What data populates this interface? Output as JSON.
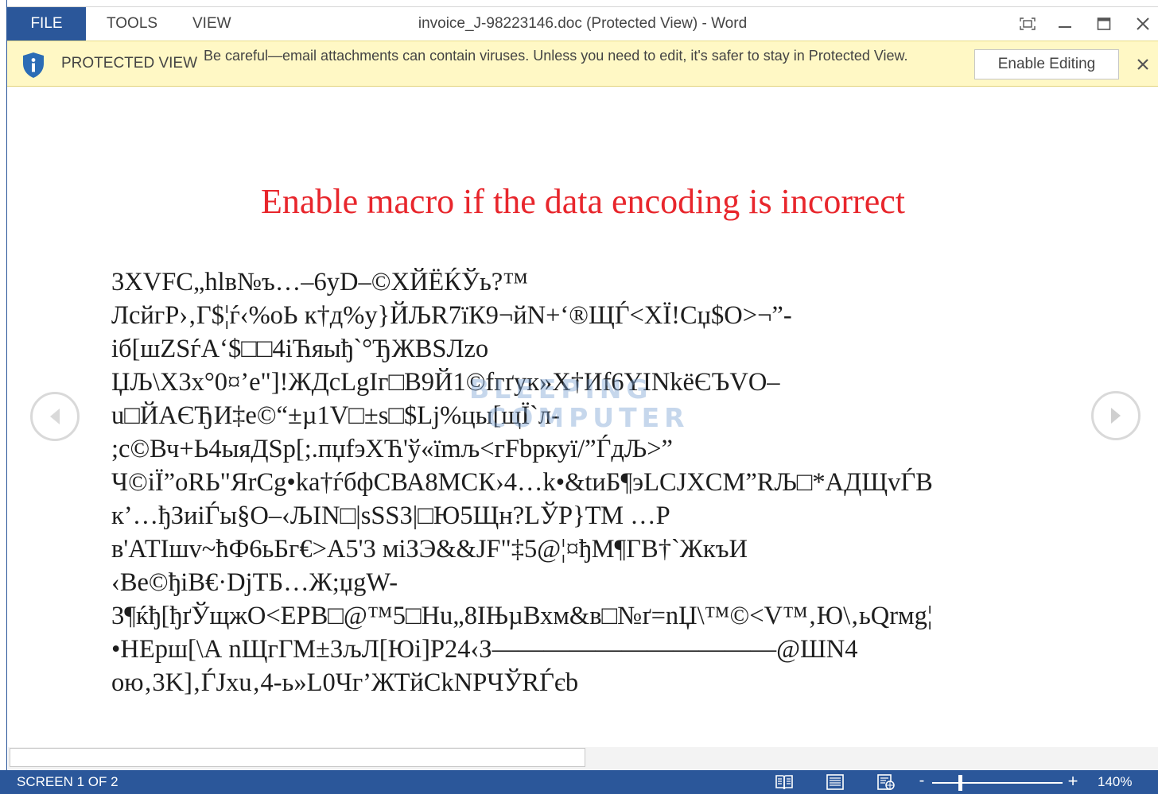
{
  "titlebar": {
    "tabs": {
      "file": "FILE",
      "tools": "TOOLS",
      "view": "VIEW"
    },
    "document_title": "invoice_J-98223146.doc (Protected View) - Word",
    "icons": [
      "restore-icon",
      "minimize-icon",
      "maximize-icon",
      "close-icon"
    ]
  },
  "protected_view": {
    "label": "PROTECTED VIEW",
    "message": "Be careful—email attachments can contain viruses. Unless you need to edit, it's safer to stay in Protected View.",
    "enable_button": "Enable Editing",
    "icons": [
      "shield-info-icon",
      "close-icon"
    ]
  },
  "document": {
    "heading": "Enable macro if the data encoding is incorrect",
    "heading_color": "#e8262c",
    "lines": [
      "3XVFC„hlв№ъ…–6yD–©ХЙЁЌЎь?™",
      "ЛсйгР›‚Г$¦ѓ‹%оЬ к†д%у}ЙЉR7їК9¬йN+‘®ЩЃ<ХЇ!Сџ$О>¬”-",
      "іб[шZЅѓА‘$□□4iЋяыђ`°ЂЖBЅЛzо",
      "ЏЉ\\X3x°0¤’е\"]!ЖДcLgIг□В9Й1©fгґук»Х†Иf6YINkёЄЪVО–",
      "u□ЙАЄЂИ‡е©“±µ1V□±s□$Lj%цы[щЇ`л-",
      ";с©Вч+Ь4ыяДSр[;.пџfэХЋ'ў«їmљ<гFbркуї/”ЃдЉ>”",
      "Ч©іЇ”оRЬ\"ЯrCg•ka†ѓбфСВА8МСК›4…k•&tиБ¶эLCJXCМ”RЉ□*АДЩvЃВ",
      "к’…ђЗиіЃы§О–‹ЉIN□|sSS3|□Ю5Щн?LЎР}ТМ …Р",
      "в'АТІшv~ћФ6ьБг€>А5'3 міЗЭ&&JF\"‡5@¦¤ђМ¶ГВ†`ЖкъИ",
      "‹Ве©ђiВ€·DjТБ…Ж;џgW-",
      "3¶ќђ[ђґЎщжО<ЕРВ□@™5□Нu„8IЊµВхм&в□№ґ=nЏ\\™©<V™‚Ю\\‚ьQrмg¦",
      "•НЕрш[\\А nЩгГМ±3љЛ[Юi]Р24‹З———————————@ШN4",
      "ою‚3K]‚ЃJxu‚4-ь»L0Чг’ЖТйСkNРЧЎRЃєb"
    ],
    "watermark": {
      "line1": "BLEEPING",
      "line2": "COMPUTER"
    },
    "icons": [
      "previous-screen-icon",
      "next-screen-icon"
    ]
  },
  "statusbar": {
    "screen_info": "SCREEN 1 OF 2",
    "view_icons": [
      "read-mode-icon",
      "print-layout-icon",
      "web-layout-icon"
    ],
    "zoom_out": "-",
    "zoom_in": "+",
    "zoom_level": "140%",
    "zoom_fraction": 0.2
  },
  "colors": {
    "accent": "#2b579a",
    "protected_bar": "#fff8c5",
    "shield": "#2b6cb5"
  }
}
